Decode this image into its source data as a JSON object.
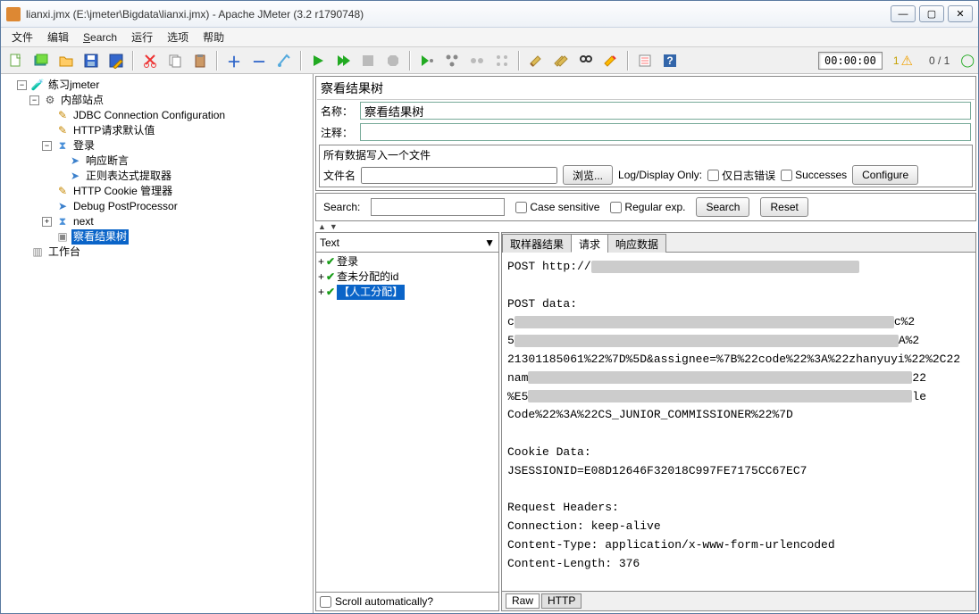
{
  "window": {
    "title": "lianxi.jmx (E:\\jmeter\\Bigdata\\lianxi.jmx) - Apache JMeter (3.2 r1790748)"
  },
  "menu": {
    "file": "文件",
    "edit": "编辑",
    "search": "Search",
    "run": "运行",
    "options": "选项",
    "help": "帮助"
  },
  "toolbar": {
    "time": "00:00:00",
    "warn_count": "1",
    "counts": "0 / 1"
  },
  "tree": {
    "root": "练习jmeter",
    "site": "内部站点",
    "jdbc": "JDBC Connection Configuration",
    "httpdef": "HTTP请求默认值",
    "login": "登录",
    "assert": "响应断言",
    "regex": "正则表达式提取器",
    "cookie": "HTTP Cookie 管理器",
    "debug": "Debug PostProcessor",
    "next": "next",
    "viewtree": "察看结果树",
    "workbench": "工作台"
  },
  "panel": {
    "title": "察看结果树",
    "name_label": "名称：",
    "name_value": "察看结果树",
    "comment_label": "注释：",
    "file_fs_title": "所有数据写入一个文件",
    "file_label": "文件名",
    "browse": "浏览...",
    "logonly": "Log/Display Only:",
    "errorsonly": "仅日志错误",
    "successes": "Successes",
    "configure": "Configure"
  },
  "searchbar": {
    "label": "Search:",
    "case": "Case sensitive",
    "regex": "Regular exp.",
    "search": "Search",
    "reset": "Reset"
  },
  "results": {
    "dropdown": "Text",
    "items": [
      "登录",
      "查未分配的id",
      "【人工分配】"
    ],
    "scroll_auto": "Scroll automatically?"
  },
  "tabs": {
    "sampler": "取样器结果",
    "request": "请求",
    "response": "响应数据"
  },
  "request_body": {
    "l1": "POST http://",
    "l2": "POST data:",
    "l3a": "c",
    "l3b": "c%2",
    "l4": "5",
    "l4a": "A%2",
    "l5a": "213",
    "l5": "01185061%22%7D%5D&assignee=%7B%22code%22%3A%22zhanyuyi%22%2C",
    "l5b": "22",
    "l6a": "nam",
    "l6b": "22",
    "l7a": "%E5",
    "l7b": "le",
    "l8": "Code%22%3A%22CS_JUNIOR_COMMISSIONER%22%7D",
    "l9": "Cookie Data:",
    "l10": "JSESSIONID=E08D12646F32018C997FE7175CC67EC7",
    "l11": "Request Headers:",
    "l12": "Connection: keep-alive",
    "l13": "Content-Type: application/x-www-form-urlencoded",
    "l14": "Content-Length: 376"
  },
  "bottom_tabs": {
    "raw": "Raw",
    "http": "HTTP"
  }
}
